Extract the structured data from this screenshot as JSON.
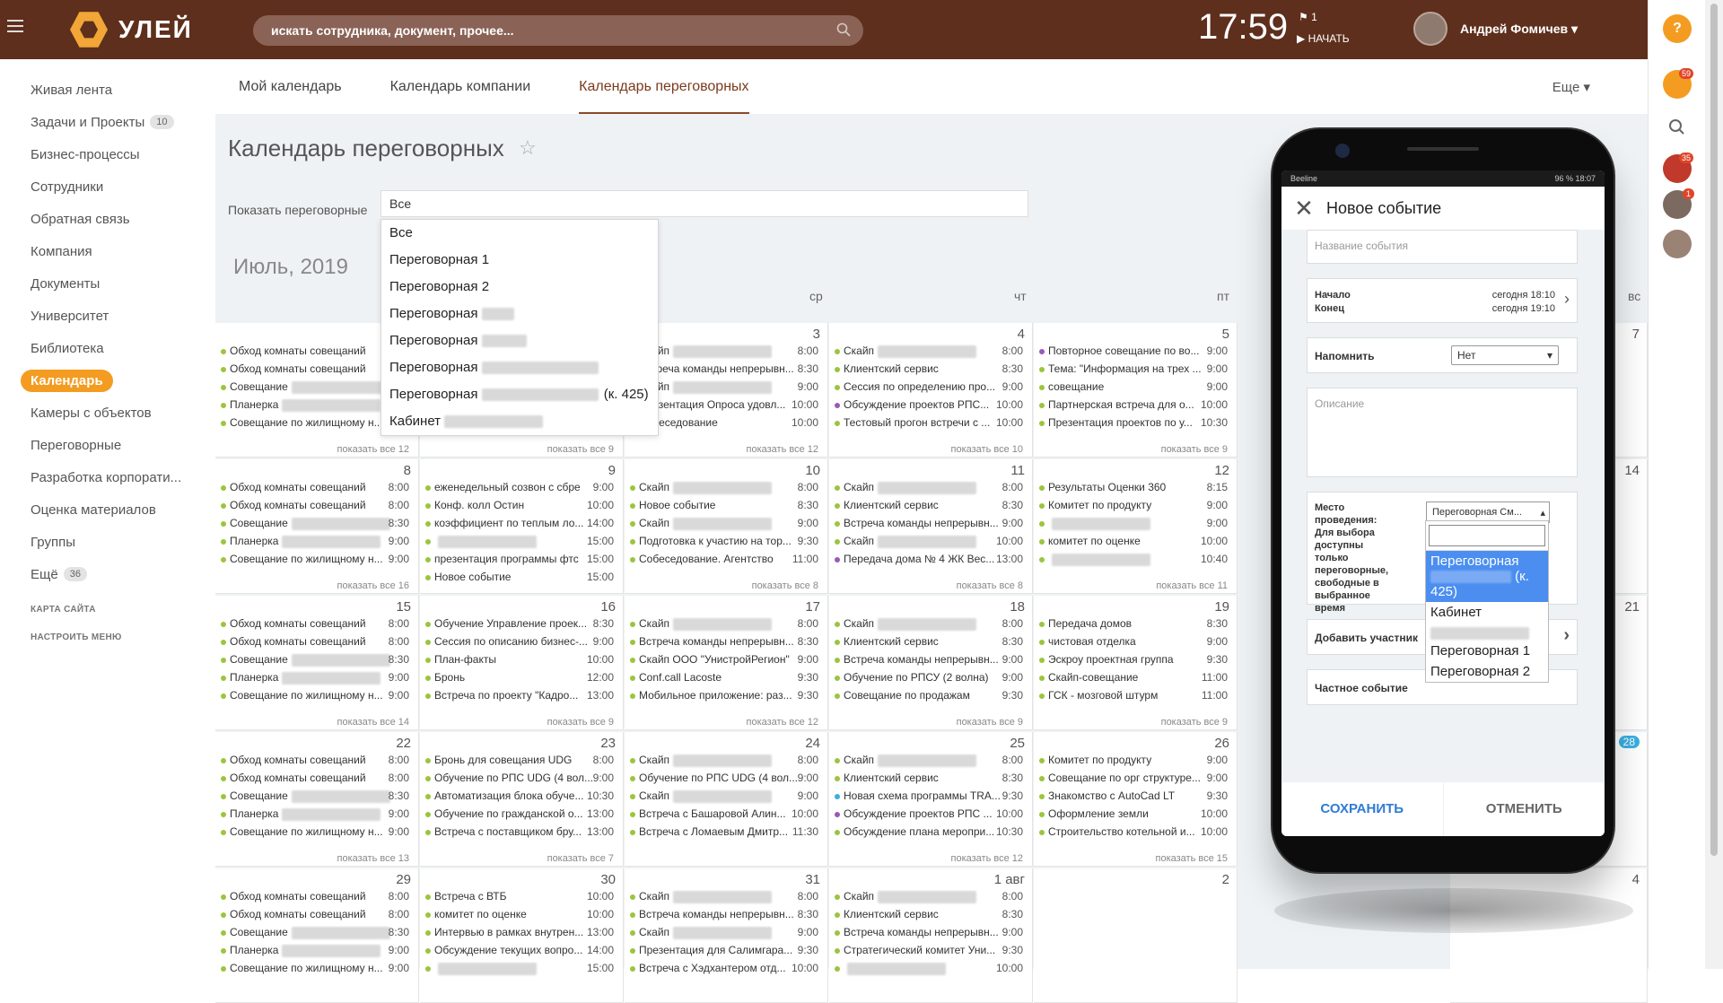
{
  "topbar": {
    "logo_text": "УЛЕЙ",
    "search_placeholder": "искать сотрудника, документ, прочее...",
    "clock": "17:59",
    "flag_count": "1",
    "start_label": "НАЧАТЬ",
    "user_name": "Андрей Фомичев"
  },
  "rail": {
    "notifications_badge": "59",
    "group_badge": "35",
    "chat_badge": "1"
  },
  "sidebar": {
    "items": [
      {
        "label": "Живая лента"
      },
      {
        "label": "Задачи и Проекты",
        "badge": "10"
      },
      {
        "label": "Бизнес-процессы"
      },
      {
        "label": "Сотрудники"
      },
      {
        "label": "Обратная связь"
      },
      {
        "label": "Компания"
      },
      {
        "label": "Документы"
      },
      {
        "label": "Университет"
      },
      {
        "label": "Библиотека"
      },
      {
        "label": "Календарь"
      },
      {
        "label": "Камеры с объектов"
      },
      {
        "label": "Переговорные"
      },
      {
        "label": "Разработка корпорати..."
      },
      {
        "label": "Оценка материалов"
      },
      {
        "label": "Группы"
      },
      {
        "label": "Ещё",
        "badge": "36"
      }
    ],
    "sitemap": "КАРТА САЙТА",
    "configure": "НАСТРОИТЬ МЕНЮ"
  },
  "tabs": {
    "my": "Мой календарь",
    "company": "Календарь компании",
    "rooms": "Календарь переговорных",
    "more": "Еще"
  },
  "page_title": "Календарь переговорных",
  "filter": {
    "label": "Показать переговорные",
    "value": "Все"
  },
  "dropdown": {
    "items": [
      "Все",
      "Переговорная 1",
      "Переговорная 2",
      "Переговорная",
      "Переговорная",
      "Переговорная",
      "Переговорная",
      "Кабинет"
    ],
    "suffix": "(к. 425)"
  },
  "month": "Июль, 2019",
  "daynames": {
    "wed": "ср",
    "thu": "чт",
    "fri": "пт",
    "sun": "вс"
  },
  "calendar": {
    "weeks": [
      {
        "days": [
          {
            "num": "",
            "events": [
              [
                "Обход комнаты совещаний",
                "8:00"
              ],
              [
                "Обход комнаты совещаний",
                "8:00"
              ],
              [
                "Совещание",
                "8:30"
              ],
              [
                "Планерка",
                "9:00"
              ],
              [
                "Совещание по жилищному н...",
                "9:00"
              ]
            ],
            "more": "показать все 12"
          },
          {
            "num": "",
            "events": [],
            "more": "показать все 9"
          },
          {
            "num": "3",
            "events": [
              [
                "Скайп",
                "8:00"
              ],
              [
                "Встреча команды непрерывн...",
                "8:30"
              ],
              [
                "Скайп",
                "9:00"
              ],
              [
                "Презентация Опроса удовл...",
                "10:00"
              ],
              [
                "Собеседование",
                "10:00"
              ]
            ],
            "more": "показать все 12"
          },
          {
            "num": "4",
            "events": [
              [
                "Скайп",
                "8:00"
              ],
              [
                "Клиентский сервис",
                "8:30"
              ],
              [
                "Сессия по определению про...",
                "9:00"
              ],
              [
                "Обсуждение проектов РПС...",
                "10:00"
              ],
              [
                "Тестовый прогон встречи с ...",
                "10:00"
              ]
            ],
            "more": "показать все 10"
          },
          {
            "num": "5",
            "events": [
              [
                "Повторное совещание по во...",
                "9:00"
              ],
              [
                "Тема: \"Информация на трех ...",
                "9:00"
              ],
              [
                "совещание",
                "9:00"
              ],
              [
                "Партнерская встреча для о...",
                "10:00"
              ],
              [
                "Презентация проектов по у...",
                "10:30"
              ]
            ],
            "more": "показать все 9"
          }
        ]
      },
      {
        "days": [
          {
            "num": "8",
            "events": [
              [
                "Обход комнаты совещаний",
                "8:00"
              ],
              [
                "Обход комнаты совещаний",
                "8:00"
              ],
              [
                "Совещание",
                "8:30"
              ],
              [
                "Планерка",
                "9:00"
              ],
              [
                "Совещание по жилищному н...",
                "9:00"
              ]
            ],
            "more": "показать все 16"
          },
          {
            "num": "9",
            "events": [
              [
                "еженедельный созвон с сбре",
                "9:00"
              ],
              [
                "Конф. колл Остин",
                "10:00"
              ],
              [
                "коэффициент по теплым ло...",
                "14:00"
              ],
              [
                "",
                "15:00"
              ],
              [
                "презентация программы фтс",
                "15:00"
              ],
              [
                "Новое событие",
                "15:00"
              ]
            ],
            "more": ""
          },
          {
            "num": "10",
            "events": [
              [
                "Скайп",
                "8:00"
              ],
              [
                "Новое событие",
                "8:30"
              ],
              [
                "Скайп",
                "9:00"
              ],
              [
                "Подготовка к участию на тор...",
                "9:30"
              ],
              [
                "Собеседование. Агентство",
                "11:00"
              ]
            ],
            "more": "показать все 8"
          },
          {
            "num": "11",
            "events": [
              [
                "Скайп",
                "8:00"
              ],
              [
                "Клиентский сервис",
                "8:30"
              ],
              [
                "Встреча команды непрерывн...",
                "9:00"
              ],
              [
                "Скайп",
                "10:00"
              ],
              [
                "Передача дома № 4 ЖК Вес...",
                "13:00"
              ]
            ],
            "more": "показать все 8"
          },
          {
            "num": "12",
            "events": [
              [
                "Результаты Оценки 360",
                "8:15"
              ],
              [
                "Комитет по продукту",
                "9:00"
              ],
              [
                "",
                "9:00"
              ],
              [
                "комитет по оценке",
                "10:00"
              ],
              [
                "",
                "10:40"
              ]
            ],
            "more": "показать все 11"
          }
        ]
      },
      {
        "days": [
          {
            "num": "15",
            "events": [
              [
                "Обход комнаты совещаний",
                "8:00"
              ],
              [
                "Обход комнаты совещаний",
                "8:00"
              ],
              [
                "Совещание",
                "8:30"
              ],
              [
                "Планерка",
                "9:00"
              ],
              [
                "Совещание по жилищному н...",
                "9:00"
              ]
            ],
            "more": "показать все 14"
          },
          {
            "num": "16",
            "events": [
              [
                "Обучение Управление проек...",
                "8:30"
              ],
              [
                "Сессия по описанию бизнес-...",
                "9:00"
              ],
              [
                "План-факты",
                "10:00"
              ],
              [
                "Бронь",
                "12:00"
              ],
              [
                "Встреча по проекту \"Кадро...",
                "13:00"
              ]
            ],
            "more": "показать все 9"
          },
          {
            "num": "17",
            "events": [
              [
                "Скайп",
                "8:00"
              ],
              [
                "Встреча команды непрерывн...",
                "8:30"
              ],
              [
                "Скайп ООО \"УнистройРегион\"",
                "9:00"
              ],
              [
                "Conf.call Lacoste",
                "9:30"
              ],
              [
                "Мобильное приложение: раз...",
                "9:30"
              ]
            ],
            "more": "показать все 12"
          },
          {
            "num": "18",
            "events": [
              [
                "Скайп",
                "8:00"
              ],
              [
                "Клиентский сервис",
                "8:30"
              ],
              [
                "Встреча команды непрерывн...",
                "9:00"
              ],
              [
                "Обучение по РПСУ (2 волна)",
                "9:00"
              ],
              [
                "Совещание по продажам",
                "9:30"
              ]
            ],
            "more": "показать все 9"
          },
          {
            "num": "19",
            "events": [
              [
                "Передача домов",
                "8:30"
              ],
              [
                "чистовая отделка",
                "9:00"
              ],
              [
                "Эскроу проектная группа",
                "9:30"
              ],
              [
                "Скайп-совещание",
                "11:00"
              ],
              [
                "ГСК - мозговой штурм",
                "11:00"
              ]
            ],
            "more": "показать все 9"
          }
        ]
      },
      {
        "days": [
          {
            "num": "22",
            "events": [
              [
                "Обход комнаты совещаний",
                "8:00"
              ],
              [
                "Обход комнаты совещаний",
                "8:00"
              ],
              [
                "Совещание",
                "8:30"
              ],
              [
                "Планерка",
                "9:00"
              ],
              [
                "Совещание по жилищному н...",
                "9:00"
              ]
            ],
            "more": "показать все 13"
          },
          {
            "num": "23",
            "events": [
              [
                "Бронь для совещания UDG",
                "8:00"
              ],
              [
                "Обучение по РПС UDG (4 вол...",
                "9:00"
              ],
              [
                "Автоматизация блока обуче...",
                "10:30"
              ],
              [
                "Обучение по гражданской о...",
                "13:00"
              ],
              [
                "Встреча с поставщиком бру...",
                "13:00"
              ]
            ],
            "more": "показать все 7"
          },
          {
            "num": "24",
            "events": [
              [
                "Скайп",
                "8:00"
              ],
              [
                "Обучение по РПС UDG (4 вол...",
                "9:00"
              ],
              [
                "Скайп",
                "9:00"
              ],
              [
                "Встреча с Башаровой Алин...",
                "10:00"
              ],
              [
                "Встреча с Ломаевым Дмитр...",
                "11:30"
              ]
            ],
            "more": ""
          },
          {
            "num": "25",
            "events": [
              [
                "Скайп",
                "8:00"
              ],
              [
                "Клиентский сервис",
                "8:30"
              ],
              [
                "Новая схема программы TRA...",
                "9:30"
              ],
              [
                "Обсуждение проектов РПС ...",
                "10:00"
              ],
              [
                "Обсуждение плана меропри...",
                "10:30"
              ]
            ],
            "more": "показать все 12"
          },
          {
            "num": "26",
            "events": [
              [
                "Комитет по продукту",
                "9:00"
              ],
              [
                "Совещание по орг структуре...",
                "9:00"
              ],
              [
                "Знакомство с AutoCad LT",
                "9:30"
              ],
              [
                "Оформление земли",
                "10:00"
              ],
              [
                "Строительство котельной и...",
                "10:00"
              ]
            ],
            "more": "показать все 15"
          }
        ]
      },
      {
        "days": [
          {
            "num": "29",
            "events": [
              [
                "Обход комнаты совещаний",
                "8:00"
              ],
              [
                "Обход комнаты совещаний",
                "8:00"
              ],
              [
                "Совещание",
                "8:30"
              ],
              [
                "Планерка",
                "9:00"
              ],
              [
                "Совещание по жилищному н...",
                "9:00"
              ]
            ],
            "more": ""
          },
          {
            "num": "30",
            "events": [
              [
                "Встреча с ВТБ",
                "10:00"
              ],
              [
                "комитет по оценке",
                "10:00"
              ],
              [
                "Интервью в рамках внутрен...",
                "13:00"
              ],
              [
                "Обсуждение текущих вопро...",
                "14:00"
              ],
              [
                "",
                "15:00"
              ]
            ],
            "more": ""
          },
          {
            "num": "31",
            "events": [
              [
                "Скайп",
                "8:00"
              ],
              [
                "Встреча команды непрерывн...",
                "8:30"
              ],
              [
                "Скайп",
                "9:00"
              ],
              [
                "Презентация для Салимгара...",
                "9:30"
              ],
              [
                "Встреча с Хэдхантером отд...",
                "10:00"
              ]
            ],
            "more": ""
          },
          {
            "num": "1 авг",
            "events": [
              [
                "Скайп",
                "8:00"
              ],
              [
                "Клиентский сервис",
                "8:30"
              ],
              [
                "Встреча команды непрерывн...",
                "9:00"
              ],
              [
                "Стратегический комитет Уни...",
                "9:30"
              ],
              [
                "",
                "10:00"
              ]
            ],
            "more": ""
          },
          {
            "num": "2",
            "events": [],
            "more": ""
          }
        ]
      }
    ],
    "sunday_nums": [
      "7",
      "14",
      "21",
      "28",
      "4"
    ]
  },
  "phone": {
    "carrier": "Beeline",
    "status_right": "96 % 18:07",
    "title": "Новое событие",
    "name_placeholder": "Название события",
    "start_label": "Начало",
    "end_label": "Конец",
    "start_value": "сегодня 18:10",
    "end_value": "сегодня 19:10",
    "remind_label": "Напомнить",
    "remind_value": "Нет",
    "desc_placeholder": "Описание",
    "location_label": "Место проведения: Для выбора доступны только переговорные, свободные в выбранное время",
    "location_value": "Переговорная См...",
    "location_options": [
      "Переговорная",
      "(к. 425)",
      "Кабинет",
      "Переговорная 1",
      "Переговорная 2"
    ],
    "add_participants": "Добавить участник",
    "private_event": "Частное событие",
    "save": "СОХРАНИТЬ",
    "cancel": "ОТМЕНИТЬ"
  }
}
